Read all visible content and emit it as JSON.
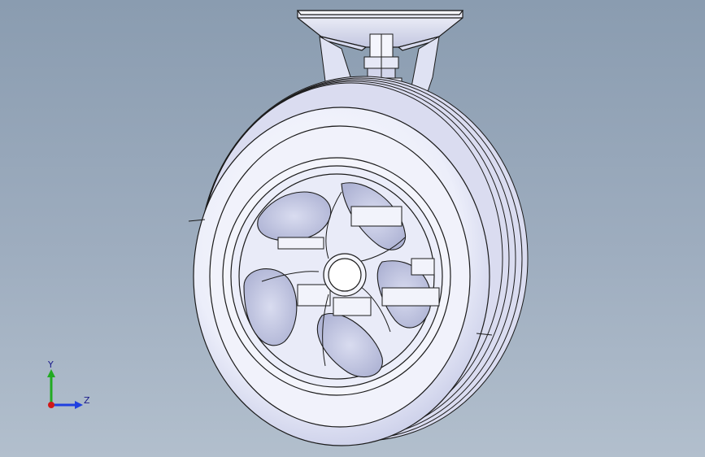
{
  "viewport": {
    "background_top": "#8a9cb0",
    "background_bottom": "#b2bfcd",
    "model_fill": "#eef0fb",
    "model_shade": "#c9cde8",
    "edge_color": "#1b1b1b"
  },
  "triad": {
    "y_label": "Y",
    "z_label": "Z",
    "y_color": "#22aa22",
    "z_color": "#1f3fe0",
    "x_color": "#d01818"
  }
}
